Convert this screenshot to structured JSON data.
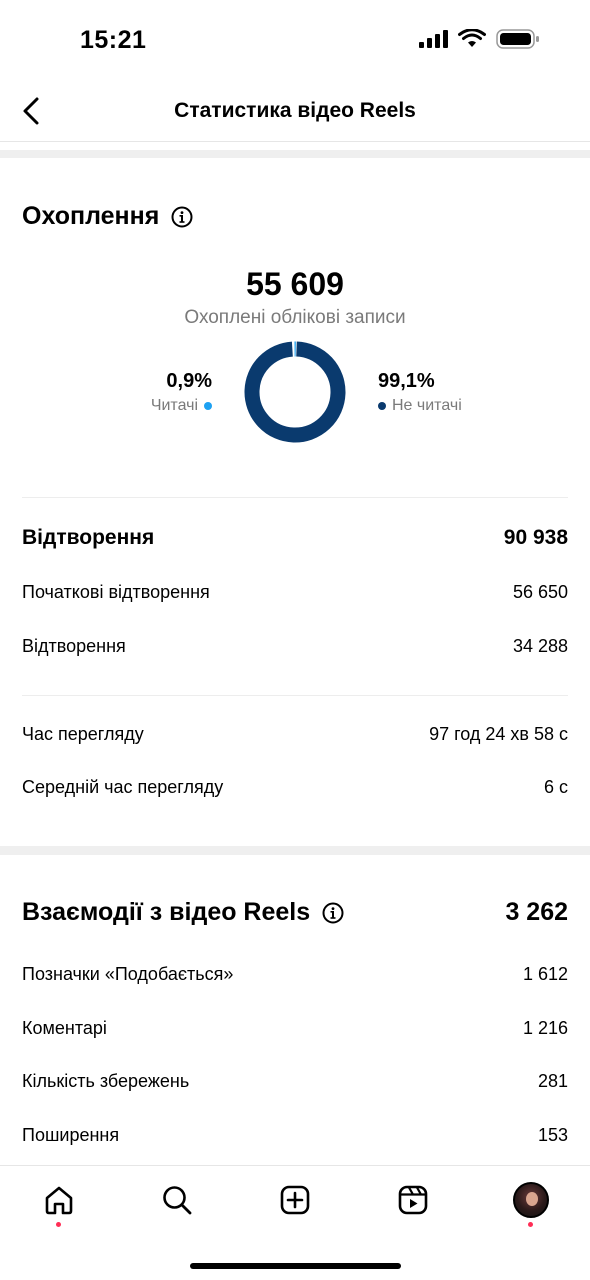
{
  "status_bar": {
    "time": "15:21"
  },
  "header": {
    "title": "Статистика відео Reels"
  },
  "reach": {
    "title": "Охоплення",
    "total": "55 609",
    "subtitle": "Охоплені облікові записи",
    "followers": {
      "pct": "0,9%",
      "label": "Читачі",
      "color": "#1da1f2",
      "share": 0.009
    },
    "non_followers": {
      "pct": "99,1%",
      "label": "Не читачі",
      "color": "#0a3a6e",
      "share": 0.991
    }
  },
  "plays": {
    "title": "Відтворення",
    "total": "90 938",
    "rows": [
      {
        "label": "Початкові відтворення",
        "value": "56 650"
      },
      {
        "label": "Відтворення",
        "value": "34 288"
      }
    ]
  },
  "watch": {
    "rows": [
      {
        "label": "Час перегляду",
        "value": "97 год 24 хв 58 с"
      },
      {
        "label": "Середній час перегляду",
        "value": "6 с"
      }
    ]
  },
  "interactions": {
    "title": "Взаємодії з відео Reels",
    "total": "3 262",
    "rows": [
      {
        "label": "Позначки «Подобається»",
        "value": "1 612"
      },
      {
        "label": "Коментарі",
        "value": "1 216"
      },
      {
        "label": "Кількість збережень",
        "value": "281"
      },
      {
        "label": "Поширення",
        "value": "153"
      }
    ]
  },
  "nav": {
    "items": [
      "home-icon",
      "search-icon",
      "create-icon",
      "reels-icon",
      "profile-avatar"
    ],
    "notification_color": "#ff2d55"
  }
}
